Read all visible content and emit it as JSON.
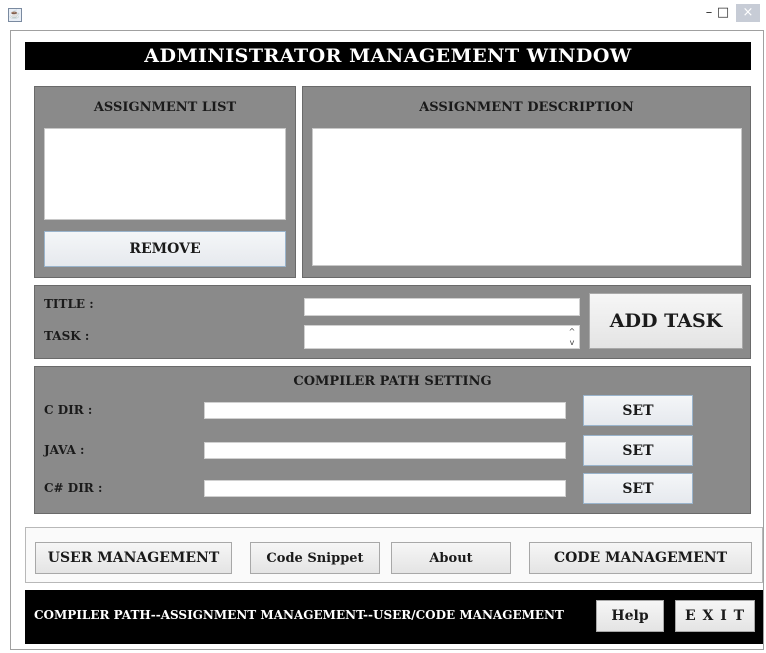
{
  "window": {
    "java_icon": "java-cup-icon",
    "minimize": "–",
    "maximize": "□",
    "close": "×"
  },
  "header": {
    "title": "ADMINISTRATOR MANAGEMENT WINDOW"
  },
  "assignment_list": {
    "label": "ASSIGNMENT LIST",
    "remove_label": "REMOVE"
  },
  "assignment_description": {
    "label": "ASSIGNMENT  DESCRIPTION"
  },
  "task_form": {
    "title_label": "TITLE :",
    "task_label": "TASK :",
    "title_value": "",
    "task_value": "",
    "add_task_label": "ADD TASK",
    "spinner_up": "^",
    "spinner_down": "v"
  },
  "compiler": {
    "heading": "COMPILER  PATH  SETTING",
    "rows": [
      {
        "label": "C DIR :",
        "value": "",
        "button": "SET"
      },
      {
        "label": "JAVA :",
        "value": "",
        "button": "SET"
      },
      {
        "label": "C# DIR :",
        "value": "",
        "button": "SET"
      }
    ]
  },
  "nav_buttons": {
    "user_management": "USER MANAGEMENT",
    "code_snippet": "Code Snippet",
    "about": "About",
    "code_management": "CODE MANAGEMENT"
  },
  "footer": {
    "text": "COMPILER PATH--ASSIGNMENT MANAGEMENT--USER/CODE MANAGEMENT",
    "help": "Help",
    "exit": "E X I T"
  }
}
